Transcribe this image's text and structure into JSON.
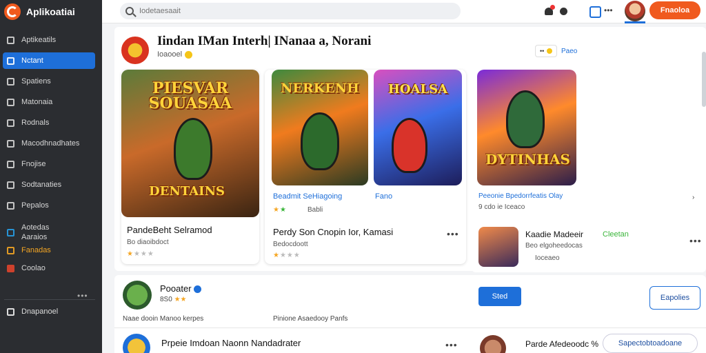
{
  "app": {
    "name": "Aplikoatiai"
  },
  "colors": {
    "accent": "#1e6fd9",
    "brand": "#f05a1e",
    "sidebar_bg": "#2b2d31"
  },
  "sidebar": {
    "items": [
      {
        "label": "Aptikeatils",
        "icon": "home-icon",
        "active": false
      },
      {
        "label": "Nctant",
        "icon": "star-icon",
        "active": true
      },
      {
        "label": "Spatiens",
        "icon": "lock-icon",
        "active": false
      },
      {
        "label": "Matonaia",
        "icon": "grid-icon",
        "active": false
      },
      {
        "label": "Rodnals",
        "icon": "tools-icon",
        "active": false
      },
      {
        "label": "Macodhnadhates",
        "icon": "tag-icon",
        "active": false
      },
      {
        "label": "Fnojise",
        "icon": "folder-icon",
        "active": false
      },
      {
        "label": "Sodtanaties",
        "icon": "edit-icon",
        "active": false
      },
      {
        "label": "Pepalos",
        "icon": "document-icon",
        "active": false
      }
    ],
    "secondary": [
      {
        "label": "Aotedas",
        "label2": "Aaraios",
        "icon": "link-icon"
      },
      {
        "label": "Fanadas",
        "icon": "apps-icon",
        "highlight": true
      },
      {
        "label": "Coolao",
        "icon": "video-icon"
      }
    ],
    "more": "•••",
    "bottom_item": "Dnapanoel"
  },
  "topbar": {
    "search_placeholder": "Iodetaesaait",
    "cta_label": "Fnaoloa"
  },
  "featured": {
    "title": "Iindan  IMan Interh| INanaa a, Norani",
    "subtitle": "Ioaooel",
    "pill_label": "Paeo",
    "cards": [
      {
        "art_title": "PIESVAR SOUASAA",
        "art_footer": "DENTAINS",
        "title": "PandeBeht  Selramod",
        "sub": "Bo diaoibdoct",
        "stars": 1
      },
      {
        "art_title": "NERKENH",
        "title": "Beadmit  SeHiagoing",
        "sub": "Babli",
        "stars": 2
      },
      {
        "art_title": "HOALSA",
        "title": "Fano"
      },
      {
        "art_title": "DYTINHAS",
        "title": "Peeonie  Bpedorrfeatis Olay",
        "sub": "9 cdo ie  Iceaco",
        "stars": 0
      }
    ],
    "wide_card": {
      "title": "Perdy  Son  Cnopin Ior, Kamasi",
      "sub": "Bedocdoott"
    },
    "side_card": {
      "title": "Kaadie  Madeeir",
      "tag": "Cleetan",
      "sub": "Beo elgoheedocas",
      "meta": "Ioceaeo"
    }
  },
  "section2": {
    "name": "Pooater",
    "rating": "8S0",
    "meta_left": "Naae dooin Manoo kerpes",
    "meta_right": "Pinione Asaedooy Panfs",
    "primary_button": "Sted",
    "outline_button": "Eapolies"
  },
  "section3": {
    "title": "Prpeie Imdoan Naonn Nandadrater",
    "side_title": "Parde Afedeoodc %",
    "pill_button": "Sapectobtoadoane"
  }
}
